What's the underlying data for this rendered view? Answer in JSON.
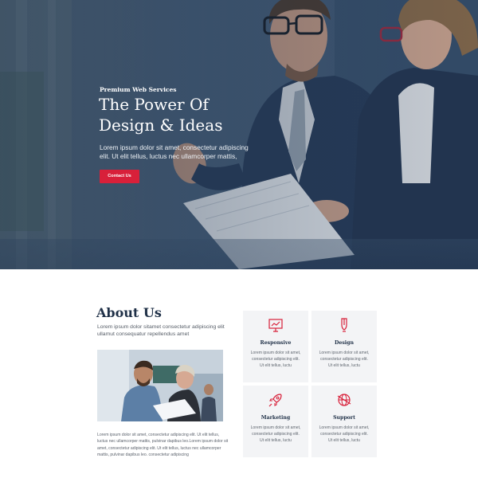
{
  "hero": {
    "eyebrow": "Premium Web Services",
    "title_line1": "The Power Of",
    "title_line2": "Design & Ideas",
    "text": "Lorem ipsum dolor sit amet, consectetur adipiscing elit. Ut elit tellus, luctus nec ullamcorper mattis,",
    "cta_label": "Contact Us"
  },
  "about": {
    "title": "About Us",
    "lead": "Lorem ipsum dolor sitamet consectetur adipiscing elit ullamut consequatur repellendus amet",
    "body": "Lorem ipsum dolor sit amet, consectetur adipiscing elit. Ut elit tellus, luctus nec ullamcorper mattis, pulvinar dapibus leo.Lorem ipsum dolor sit amet, consectetur adipiscing elit. Ut elit tellus, luctus nec ullamcorper mattis, pulvinar dapibus leo. consectetur adipiscing"
  },
  "services": [
    {
      "title": "Responsive",
      "icon": "presentation-chart-icon",
      "text": "Lorem ipsum dolor sit amet, consectetur adipiscing elit. Ut elit tellus, luctu"
    },
    {
      "title": "Design",
      "icon": "pen-tool-icon",
      "text": "Lorem ipsum dolor sit amet, consectetur adipiscing elit. Ut elit tellus, luctu"
    },
    {
      "title": "Marketing",
      "icon": "rocket-icon",
      "text": "Lorem ipsum dolor sit amet, consectetur adipiscing elit. Ut elit tellus, luctu"
    },
    {
      "title": "Support",
      "icon": "globe-support-icon",
      "text": "Lorem ipsum dolor sit amet, consectetur adipiscing elit. Ut elit tellus, luctu"
    }
  ],
  "colors": {
    "accent": "#d8203a",
    "navy": "#1f3047",
    "hero_overlay": "#2c3f58",
    "card_bg": "#f3f4f6"
  }
}
